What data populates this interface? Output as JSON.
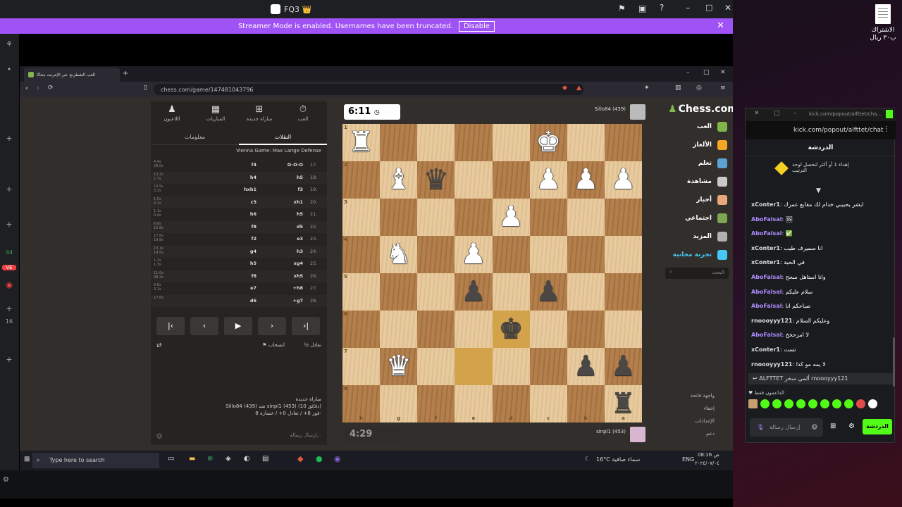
{
  "desktop": {
    "file_label": "الاشتراك ب٣٠ ريال"
  },
  "discord": {
    "title": "FQ3 👑",
    "banner_text": "Streamer Mode is enabled. Usernames have been truncated.",
    "banner_button": "Disable",
    "rail": [
      "44",
      "VE",
      "16"
    ]
  },
  "browser": {
    "tab_title": "العب الشطرنج عبر الإنترنت مجانًا",
    "url": "chess.com/game/147481043796"
  },
  "chess_panel": {
    "tabs": [
      "العب",
      "مباراة جديدة",
      "المباريات",
      "اللاعبون"
    ],
    "subtabs": [
      "النقلات",
      "معلومات"
    ],
    "opening": "Vienna Game: Max Lange Defense",
    "moves": [
      {
        "n": "17.",
        "w": "O-O-O",
        "b": "f4",
        "t": "4.4s\n29.0s"
      },
      {
        "n": "18.",
        "w": "h5",
        "b": "h4",
        "t": "12.2s\n1.7s"
      },
      {
        "n": "19.",
        "w": "f3",
        "b": "hxh1",
        "t": "14.5s\n3.2s"
      },
      {
        "n": "20.",
        "w": "xh1",
        "b": "c5",
        "t": "1.5s\n0.2s"
      },
      {
        "n": "21.",
        "w": "h5",
        "b": "h6",
        "t": "1.1s\n0.4s"
      },
      {
        "n": "22.",
        "w": "d5",
        "b": "f8",
        "t": "6.8s\n15.8s"
      },
      {
        "n": "23.",
        "w": "e3",
        "b": "f2",
        "t": "17.6s\n19.8s"
      },
      {
        "n": "24.",
        "w": "h3",
        "b": "g4",
        "t": "13.1s\n14.5s"
      },
      {
        "n": "25.",
        "w": "xg4",
        "b": "h5",
        "t": "1.2s\n1.3s"
      },
      {
        "n": "26.",
        "w": "xh5",
        "b": "f8",
        "t": "11.0s\n48.2s"
      },
      {
        "n": "27.",
        "w": "+h8",
        "b": "e7",
        "t": "9.6s\n3.1s"
      },
      {
        "n": "28.",
        "w": "+g7",
        "b": "d6",
        "t": "17.6s"
      }
    ],
    "draw_label": "تعادل",
    "resign_label": "انسحاب",
    "game_info": [
      "مباراة جديدة",
      "Sillo84 (439) ضد sinpl1 (453) (10 دقائق)",
      "فوز 8+ / تعادل 0+ / خسارة 8-"
    ],
    "message_placeholder": "إرسال رسالة..."
  },
  "board": {
    "clock_top": "6:11",
    "clock_bottom": "4:29",
    "opponent": "Sillo84 (439)",
    "me": "sinpl1 (453)",
    "ranks": [
      "1",
      "2",
      "3",
      "4",
      "5",
      "6",
      "7",
      "8"
    ],
    "files": [
      "h",
      "g",
      "f",
      "e",
      "d",
      "c",
      "b",
      "a"
    ],
    "pieces": [
      [
        "wR",
        "",
        "",
        "",
        "",
        "wK",
        "",
        ""
      ],
      [
        "",
        "wB",
        "bQ",
        "",
        "",
        "wP",
        "wP",
        "wP"
      ],
      [
        "",
        "",
        "",
        "",
        "wP",
        "",
        "",
        ""
      ],
      [
        "",
        "wN",
        "",
        "wP",
        "",
        "",
        "",
        ""
      ],
      [
        "",
        "",
        "",
        "bP",
        "",
        "bP",
        "",
        ""
      ],
      [
        "",
        "",
        "",
        "",
        "bK",
        "",
        "",
        ""
      ],
      [
        "",
        "wQ",
        "",
        "",
        "",
        "",
        "bP",
        "bP"
      ],
      [
        "",
        "",
        "",
        "",
        "",
        "",
        "",
        "bR"
      ]
    ],
    "highlights": [
      [
        6,
        3
      ],
      [
        5,
        4
      ]
    ]
  },
  "chess_nav": {
    "logo": "Chess.com",
    "items": [
      "العب",
      "الألغاز",
      "تعلم",
      "مشاهدة",
      "أخبار",
      "اجتماعي",
      "المزيد",
      "تجربة مجانية"
    ],
    "search": "البحث",
    "bottom": [
      "واجهة فاتحة",
      "إخفاء",
      "الإعدادات",
      "دعم"
    ],
    "colors": [
      "#81b64c",
      "#f5a623",
      "#5da2d5",
      "#c9c9c9",
      "#e8a87c",
      "#7fa650",
      "#b0b0b0",
      "#46c7f5"
    ]
  },
  "taskbar": {
    "search": "Type here to search",
    "weather": "16°C سماء صافية",
    "lang": "ENG",
    "time": "08:16 ص",
    "date": "٢٠٢٤/٠٧/٠٤"
  },
  "kick": {
    "window_title": "kick.com/popout/alfttet/cha...",
    "url": "kick.com/popout/alfttet/chat",
    "header": "الدردشة",
    "gift_text": "إهداء 1 أو أكثر لتحصل لوحة الترتيب",
    "messages": [
      {
        "u": "xConter1",
        "m": "ابشر يحبيبي خدام لك مقابع عمرك",
        "c": "#dcdcdc"
      },
      {
        "u": "AboFalsal",
        "m": "🖼",
        "c": "#b08cff"
      },
      {
        "u": "AboFalsal",
        "m": "✅",
        "c": "#b08cff"
      },
      {
        "u": "xConter1",
        "m": "انا سميرف طيب",
        "c": "#dcdcdc"
      },
      {
        "u": "xConter1",
        "m": "في الحبة",
        "c": "#dcdcdc"
      },
      {
        "u": "AboFalsal",
        "m": "وانا استاهل سحح",
        "c": "#b08cff"
      },
      {
        "u": "AboFalsal",
        "m": "سلام عليكم",
        "c": "#b08cff"
      },
      {
        "u": "AboFalsal",
        "m": "صباحكم انا",
        "c": "#b08cff"
      },
      {
        "u": "rnoooyyy121",
        "m": "وعليكم السلام",
        "c": "#dcdcdc"
      },
      {
        "u": "AboFalsal",
        "m": "لا امزحخخ",
        "c": "#b08cff"
      },
      {
        "u": "xConter1",
        "m": "تست",
        "c": "#dcdcdc"
      },
      {
        "u": "rnoooyyy121",
        "m": "لا يمه مو كذا",
        "c": "#dcdcdc"
      }
    ],
    "pinned": "ALFTTET ألمي سخر rnoooyyy121",
    "supporters_label": "الداعمون فقط",
    "input_placeholder": "إرسال رسالة",
    "send_label": "الدردشة"
  }
}
